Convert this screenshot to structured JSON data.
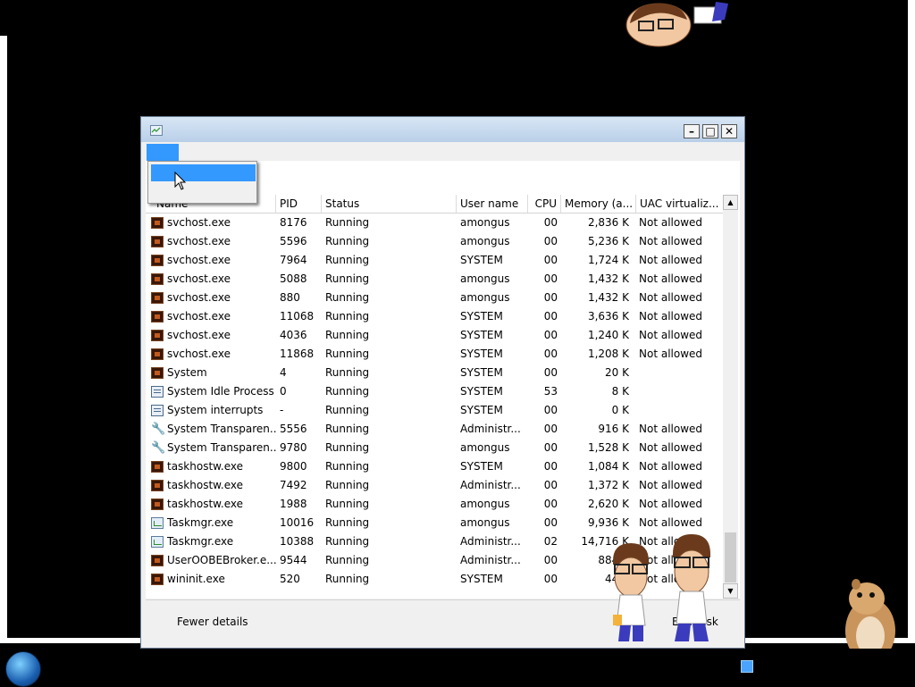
{
  "window": {
    "title": "",
    "minimize_glyph": "–",
    "maximize_glyph": "□",
    "close_glyph": "✕"
  },
  "menu": {
    "selected_item": ""
  },
  "dropdown": {
    "items": [
      ""
    ]
  },
  "columns": [
    "Name",
    "PID",
    "Status",
    "User name",
    "CPU",
    "Memory (a...",
    "UAC virtualiz..."
  ],
  "processes": [
    {
      "name": "svchost.exe",
      "pid": "8176",
      "status": "Running",
      "user": "amongus",
      "cpu": "00",
      "mem": "2,836 K",
      "uac": "Not allowed",
      "icon": "service-icon"
    },
    {
      "name": "svchost.exe",
      "pid": "5596",
      "status": "Running",
      "user": "amongus",
      "cpu": "00",
      "mem": "5,236 K",
      "uac": "Not allowed",
      "icon": "service-icon"
    },
    {
      "name": "svchost.exe",
      "pid": "7964",
      "status": "Running",
      "user": "SYSTEM",
      "cpu": "00",
      "mem": "1,724 K",
      "uac": "Not allowed",
      "icon": "service-icon"
    },
    {
      "name": "svchost.exe",
      "pid": "5088",
      "status": "Running",
      "user": "amongus",
      "cpu": "00",
      "mem": "1,432 K",
      "uac": "Not allowed",
      "icon": "service-icon"
    },
    {
      "name": "svchost.exe",
      "pid": "880",
      "status": "Running",
      "user": "amongus",
      "cpu": "00",
      "mem": "1,432 K",
      "uac": "Not allowed",
      "icon": "service-icon"
    },
    {
      "name": "svchost.exe",
      "pid": "11068",
      "status": "Running",
      "user": "SYSTEM",
      "cpu": "00",
      "mem": "3,636 K",
      "uac": "Not allowed",
      "icon": "service-icon"
    },
    {
      "name": "svchost.exe",
      "pid": "4036",
      "status": "Running",
      "user": "SYSTEM",
      "cpu": "00",
      "mem": "1,240 K",
      "uac": "Not allowed",
      "icon": "service-icon"
    },
    {
      "name": "svchost.exe",
      "pid": "11868",
      "status": "Running",
      "user": "SYSTEM",
      "cpu": "00",
      "mem": "1,208 K",
      "uac": "Not allowed",
      "icon": "service-icon"
    },
    {
      "name": "System",
      "pid": "4",
      "status": "Running",
      "user": "SYSTEM",
      "cpu": "00",
      "mem": "20 K",
      "uac": "",
      "icon": "service-icon"
    },
    {
      "name": "System Idle Process",
      "pid": "0",
      "status": "Running",
      "user": "SYSTEM",
      "cpu": "53",
      "mem": "8 K",
      "uac": "",
      "icon": "window-icon"
    },
    {
      "name": "System interrupts",
      "pid": "-",
      "status": "Running",
      "user": "SYSTEM",
      "cpu": "00",
      "mem": "0 K",
      "uac": "",
      "icon": "window-icon"
    },
    {
      "name": "System Transparen...",
      "pid": "5556",
      "status": "Running",
      "user": "Administr...",
      "cpu": "00",
      "mem": "916 K",
      "uac": "Not allowed",
      "icon": "wrench-icon"
    },
    {
      "name": "System Transparen...",
      "pid": "9780",
      "status": "Running",
      "user": "amongus",
      "cpu": "00",
      "mem": "1,528 K",
      "uac": "Not allowed",
      "icon": "wrench-icon"
    },
    {
      "name": "taskhostw.exe",
      "pid": "9800",
      "status": "Running",
      "user": "SYSTEM",
      "cpu": "00",
      "mem": "1,084 K",
      "uac": "Not allowed",
      "icon": "service-icon"
    },
    {
      "name": "taskhostw.exe",
      "pid": "7492",
      "status": "Running",
      "user": "Administr...",
      "cpu": "00",
      "mem": "1,372 K",
      "uac": "Not allowed",
      "icon": "service-icon"
    },
    {
      "name": "taskhostw.exe",
      "pid": "1988",
      "status": "Running",
      "user": "amongus",
      "cpu": "00",
      "mem": "2,620 K",
      "uac": "Not allowed",
      "icon": "service-icon"
    },
    {
      "name": "Taskmgr.exe",
      "pid": "10016",
      "status": "Running",
      "user": "amongus",
      "cpu": "00",
      "mem": "9,936 K",
      "uac": "Not allowed",
      "icon": "taskmgr-icon"
    },
    {
      "name": "Taskmgr.exe",
      "pid": "10388",
      "status": "Running",
      "user": "Administr...",
      "cpu": "02",
      "mem": "14,716 K",
      "uac": "Not allowed",
      "icon": "taskmgr-icon"
    },
    {
      "name": "UserOOBEBroker.e...",
      "pid": "9544",
      "status": "Running",
      "user": "Administr...",
      "cpu": "00",
      "mem": "884 K",
      "uac": "Not allowed",
      "icon": "service-icon"
    },
    {
      "name": "wininit.exe",
      "pid": "520",
      "status": "Running",
      "user": "SYSTEM",
      "cpu": "00",
      "mem": "44 K",
      "uac": "Not allowed",
      "icon": "service-icon"
    }
  ],
  "footer": {
    "fewer_details": "Fewer details",
    "end_task": "End task"
  },
  "colors": {
    "selection": "#3399ff",
    "titlebar": "#c7d9ee",
    "desktop": "#000000"
  }
}
